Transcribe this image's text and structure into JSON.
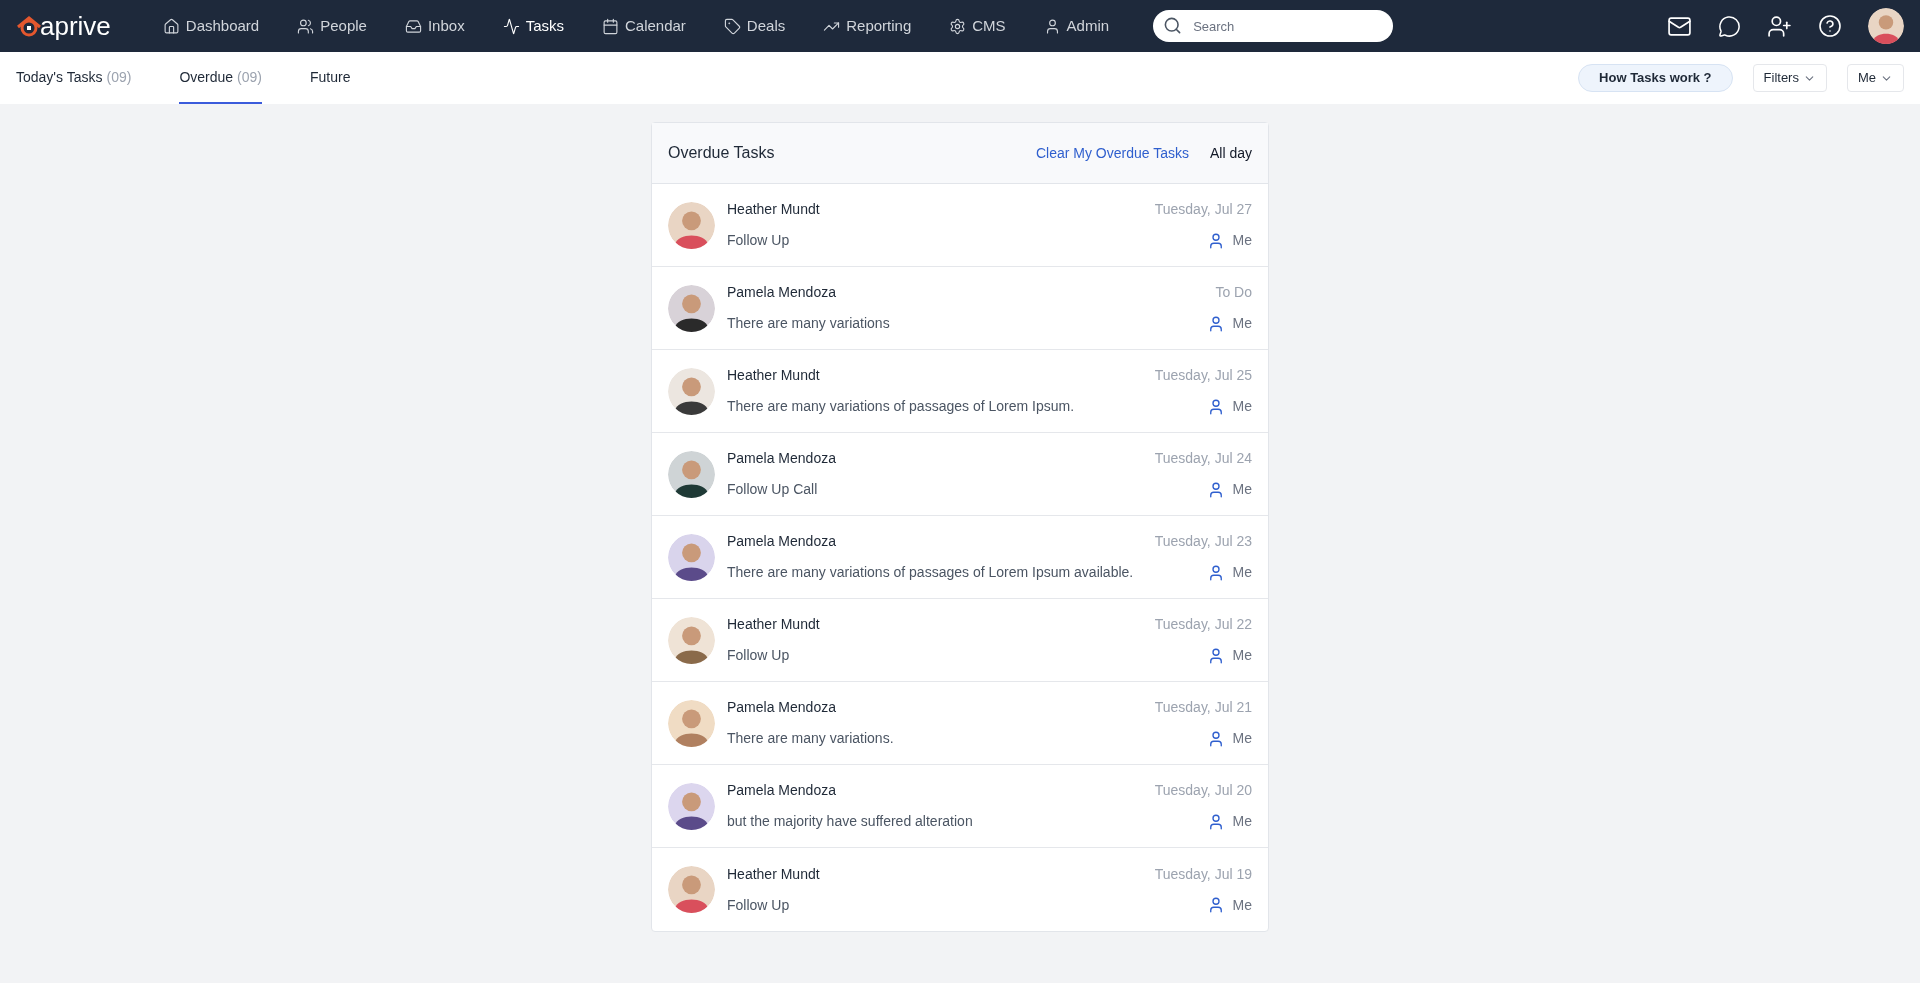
{
  "brand": {
    "name": "aprive"
  },
  "nav": [
    {
      "label": "Dashboard",
      "selected": false
    },
    {
      "label": "People",
      "selected": false
    },
    {
      "label": "Inbox",
      "selected": false
    },
    {
      "label": "Tasks",
      "selected": true
    },
    {
      "label": "Calendar",
      "selected": false
    },
    {
      "label": "Deals",
      "selected": false
    },
    {
      "label": "Reporting",
      "selected": false
    },
    {
      "label": "CMS",
      "selected": false
    },
    {
      "label": "Admin",
      "selected": false
    }
  ],
  "search": {
    "placeholder": "Search"
  },
  "tabs": [
    {
      "label": "Today's Tasks",
      "count": "(09)",
      "selected": false
    },
    {
      "label": "Overdue",
      "count": "(09)",
      "selected": true
    },
    {
      "label": "Future",
      "selected": false
    }
  ],
  "toolbar": {
    "help": "How Tasks work ?",
    "filters": "Filters",
    "owner": "Me"
  },
  "panel": {
    "title": "Overdue Tasks",
    "clear_link": "Clear My Overdue Tasks",
    "all_day": "All day",
    "tasks": [
      {
        "name": "Heather Mundt",
        "text": "Follow Up",
        "due": "Tuesday, Jul 27",
        "assignee": "Me"
      },
      {
        "name": "Pamela Mendoza",
        "text": "There are many variations",
        "due": "To Do",
        "assignee": "Me"
      },
      {
        "name": "Heather Mundt",
        "text": "There are many variations of passages of Lorem Ipsum.",
        "due": "Tuesday, Jul 25",
        "assignee": "Me"
      },
      {
        "name": "Pamela Mendoza",
        "text": "Follow Up Call",
        "due": "Tuesday, Jul 24",
        "assignee": "Me"
      },
      {
        "name": "Pamela Mendoza",
        "text": "There are many variations of passages of Lorem Ipsum available.",
        "due": "Tuesday, Jul 23",
        "assignee": "Me"
      },
      {
        "name": "Heather Mundt",
        "text": "Follow Up",
        "due": "Tuesday, Jul 22",
        "assignee": "Me"
      },
      {
        "name": "Pamela Mendoza",
        "text": "There are many variations.",
        "due": "Tuesday, Jul 21",
        "assignee": "Me"
      },
      {
        "name": "Pamela Mendoza",
        "text": "but the majority have suffered alteration",
        "due": "Tuesday, Jul 20",
        "assignee": "Me"
      },
      {
        "name": "Heather Mundt",
        "text": "Follow Up",
        "due": "Tuesday, Jul 19",
        "assignee": "Me"
      }
    ]
  }
}
